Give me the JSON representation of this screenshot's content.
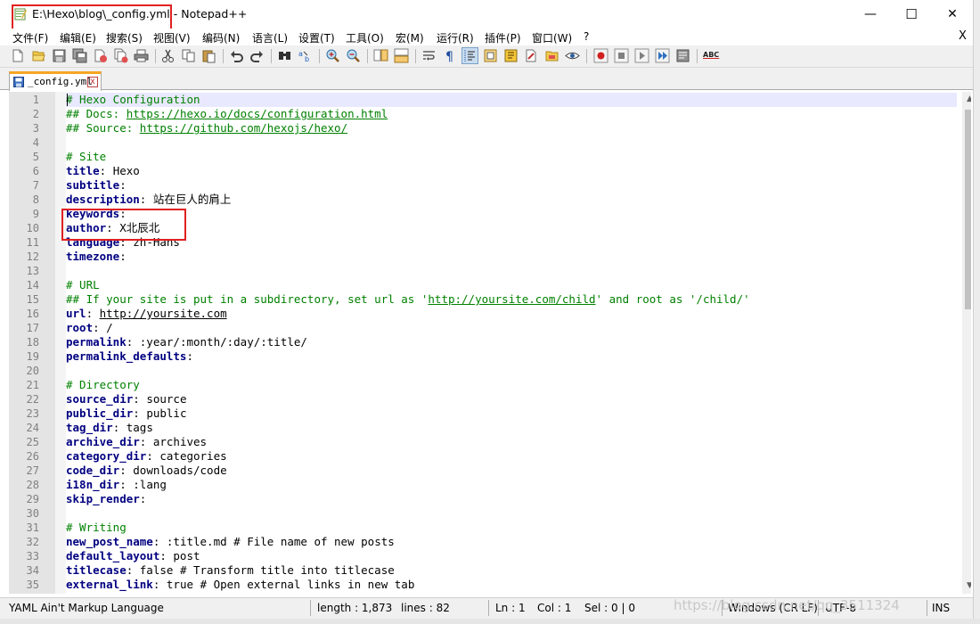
{
  "window": {
    "title": "E:\\Hexo\\blog\\_config.yml - Notepad++",
    "minimize": "—",
    "maximize": "☐",
    "close": "✕"
  },
  "menu": {
    "items": [
      "文件(F)",
      "编辑(E)",
      "搜索(S)",
      "视图(V)",
      "编码(N)",
      "语言(L)",
      "设置(T)",
      "工具(O)",
      "宏(M)",
      "运行(R)",
      "插件(P)",
      "窗口(W)",
      "?"
    ],
    "close_doc": "X"
  },
  "toolbar": {
    "icons": [
      "new-file-icon",
      "open-file-icon",
      "save-icon",
      "save-all-icon",
      "close-icon",
      "close-all-icon",
      "print-icon",
      "cut-icon",
      "copy-icon",
      "paste-icon",
      "undo-icon",
      "redo-icon",
      "find-icon",
      "replace-icon",
      "zoom-in-icon",
      "zoom-out-icon",
      "sync-vertical-icon",
      "sync-horizontal-icon",
      "word-wrap-icon",
      "show-all-chars-icon",
      "indent-guide-icon",
      "doc-map-icon",
      "function-list-icon",
      "folder-workspace-icon",
      "monitoring-icon",
      "record-macro-icon",
      "stop-macro-icon",
      "play-macro-icon",
      "run-macro-multiple-icon",
      "save-macro-icon",
      "spell-check-icon"
    ],
    "spell_label": "ABC"
  },
  "tab": {
    "label": "_config.yml",
    "close": "x"
  },
  "editor": {
    "lines": [
      {
        "n": "1",
        "parts": [
          {
            "t": "# Hexo Configuration",
            "c": "cmt"
          }
        ]
      },
      {
        "n": "2",
        "parts": [
          {
            "t": "## Docs: ",
            "c": "cmt"
          },
          {
            "t": "https://hexo.io/docs/configuration.html",
            "c": "url"
          }
        ]
      },
      {
        "n": "3",
        "parts": [
          {
            "t": "## Source: ",
            "c": "cmt"
          },
          {
            "t": "https://github.com/hexojs/hexo/",
            "c": "url"
          }
        ]
      },
      {
        "n": "4",
        "parts": []
      },
      {
        "n": "5",
        "parts": [
          {
            "t": "# Site",
            "c": "cmt"
          }
        ]
      },
      {
        "n": "6",
        "parts": [
          {
            "t": "title",
            "c": "key"
          },
          {
            "t": ": Hexo",
            "c": "val"
          }
        ]
      },
      {
        "n": "7",
        "parts": [
          {
            "t": "subtitle",
            "c": "key"
          },
          {
            "t": ":",
            "c": "val"
          }
        ]
      },
      {
        "n": "8",
        "parts": [
          {
            "t": "description",
            "c": "key"
          },
          {
            "t": ": 站在巨人的肩上",
            "c": "val"
          }
        ]
      },
      {
        "n": "9",
        "parts": [
          {
            "t": "keywords",
            "c": "key"
          },
          {
            "t": ":",
            "c": "val"
          }
        ]
      },
      {
        "n": "10",
        "parts": [
          {
            "t": "author",
            "c": "key"
          },
          {
            "t": ": X北辰北",
            "c": "val"
          }
        ]
      },
      {
        "n": "11",
        "parts": [
          {
            "t": "language",
            "c": "key"
          },
          {
            "t": ": zh-Hans",
            "c": "val"
          }
        ]
      },
      {
        "n": "12",
        "parts": [
          {
            "t": "timezone",
            "c": "key"
          },
          {
            "t": ":",
            "c": "val"
          }
        ]
      },
      {
        "n": "13",
        "parts": []
      },
      {
        "n": "14",
        "parts": [
          {
            "t": "# URL",
            "c": "cmt"
          }
        ]
      },
      {
        "n": "15",
        "parts": [
          {
            "t": "## If your site is put in a subdirectory, set url as '",
            "c": "cmt"
          },
          {
            "t": "http://yoursite.com/child",
            "c": "url"
          },
          {
            "t": "' and root as '/child/'",
            "c": "cmt"
          }
        ]
      },
      {
        "n": "16",
        "parts": [
          {
            "t": "url",
            "c": "key"
          },
          {
            "t": ": ",
            "c": "val"
          },
          {
            "t": "http://yoursite.com",
            "c": "val url-black"
          }
        ]
      },
      {
        "n": "17",
        "parts": [
          {
            "t": "root",
            "c": "key"
          },
          {
            "t": ": /",
            "c": "val"
          }
        ]
      },
      {
        "n": "18",
        "parts": [
          {
            "t": "permalink",
            "c": "key"
          },
          {
            "t": ": :year/:month/:day/:title/",
            "c": "val"
          }
        ]
      },
      {
        "n": "19",
        "parts": [
          {
            "t": "permalink_defaults",
            "c": "key"
          },
          {
            "t": ":",
            "c": "val"
          }
        ]
      },
      {
        "n": "20",
        "parts": []
      },
      {
        "n": "21",
        "parts": [
          {
            "t": "# Directory",
            "c": "cmt"
          }
        ]
      },
      {
        "n": "22",
        "parts": [
          {
            "t": "source_dir",
            "c": "key"
          },
          {
            "t": ": source",
            "c": "val"
          }
        ]
      },
      {
        "n": "23",
        "parts": [
          {
            "t": "public_dir",
            "c": "key"
          },
          {
            "t": ": public",
            "c": "val"
          }
        ]
      },
      {
        "n": "24",
        "parts": [
          {
            "t": "tag_dir",
            "c": "key"
          },
          {
            "t": ": tags",
            "c": "val"
          }
        ]
      },
      {
        "n": "25",
        "parts": [
          {
            "t": "archive_dir",
            "c": "key"
          },
          {
            "t": ": archives",
            "c": "val"
          }
        ]
      },
      {
        "n": "26",
        "parts": [
          {
            "t": "category_dir",
            "c": "key"
          },
          {
            "t": ": categories",
            "c": "val"
          }
        ]
      },
      {
        "n": "27",
        "parts": [
          {
            "t": "code_dir",
            "c": "key"
          },
          {
            "t": ": downloads/code",
            "c": "val"
          }
        ]
      },
      {
        "n": "28",
        "parts": [
          {
            "t": "i18n_dir",
            "c": "key"
          },
          {
            "t": ": :lang",
            "c": "val"
          }
        ]
      },
      {
        "n": "29",
        "parts": [
          {
            "t": "skip_render",
            "c": "key"
          },
          {
            "t": ":",
            "c": "val"
          }
        ]
      },
      {
        "n": "30",
        "parts": []
      },
      {
        "n": "31",
        "parts": [
          {
            "t": "# Writing",
            "c": "cmt"
          }
        ]
      },
      {
        "n": "32",
        "parts": [
          {
            "t": "new_post_name",
            "c": "key"
          },
          {
            "t": ": :title.md # File name of new posts",
            "c": "val"
          }
        ]
      },
      {
        "n": "33",
        "parts": [
          {
            "t": "default_layout",
            "c": "key"
          },
          {
            "t": ": post",
            "c": "val"
          }
        ]
      },
      {
        "n": "34",
        "parts": [
          {
            "t": "titlecase",
            "c": "key"
          },
          {
            "t": ": false # Transform title into titlecase",
            "c": "val"
          }
        ]
      },
      {
        "n": "35",
        "parts": [
          {
            "t": "external_link",
            "c": "key"
          },
          {
            "t": ": true # Open external links in new tab",
            "c": "val"
          }
        ]
      }
    ]
  },
  "status": {
    "language": "YAML Ain't Markup Language",
    "length": "length : 1,873",
    "lines": "lines : 82",
    "ln": "Ln : 1",
    "col": "Col : 1",
    "sel": "Sel : 0 | 0",
    "eol": "Windows (CR LF)",
    "encoding": "UTF-8",
    "mode": "INS"
  },
  "watermark": "https://blog.csdn.net/qq_3511324"
}
